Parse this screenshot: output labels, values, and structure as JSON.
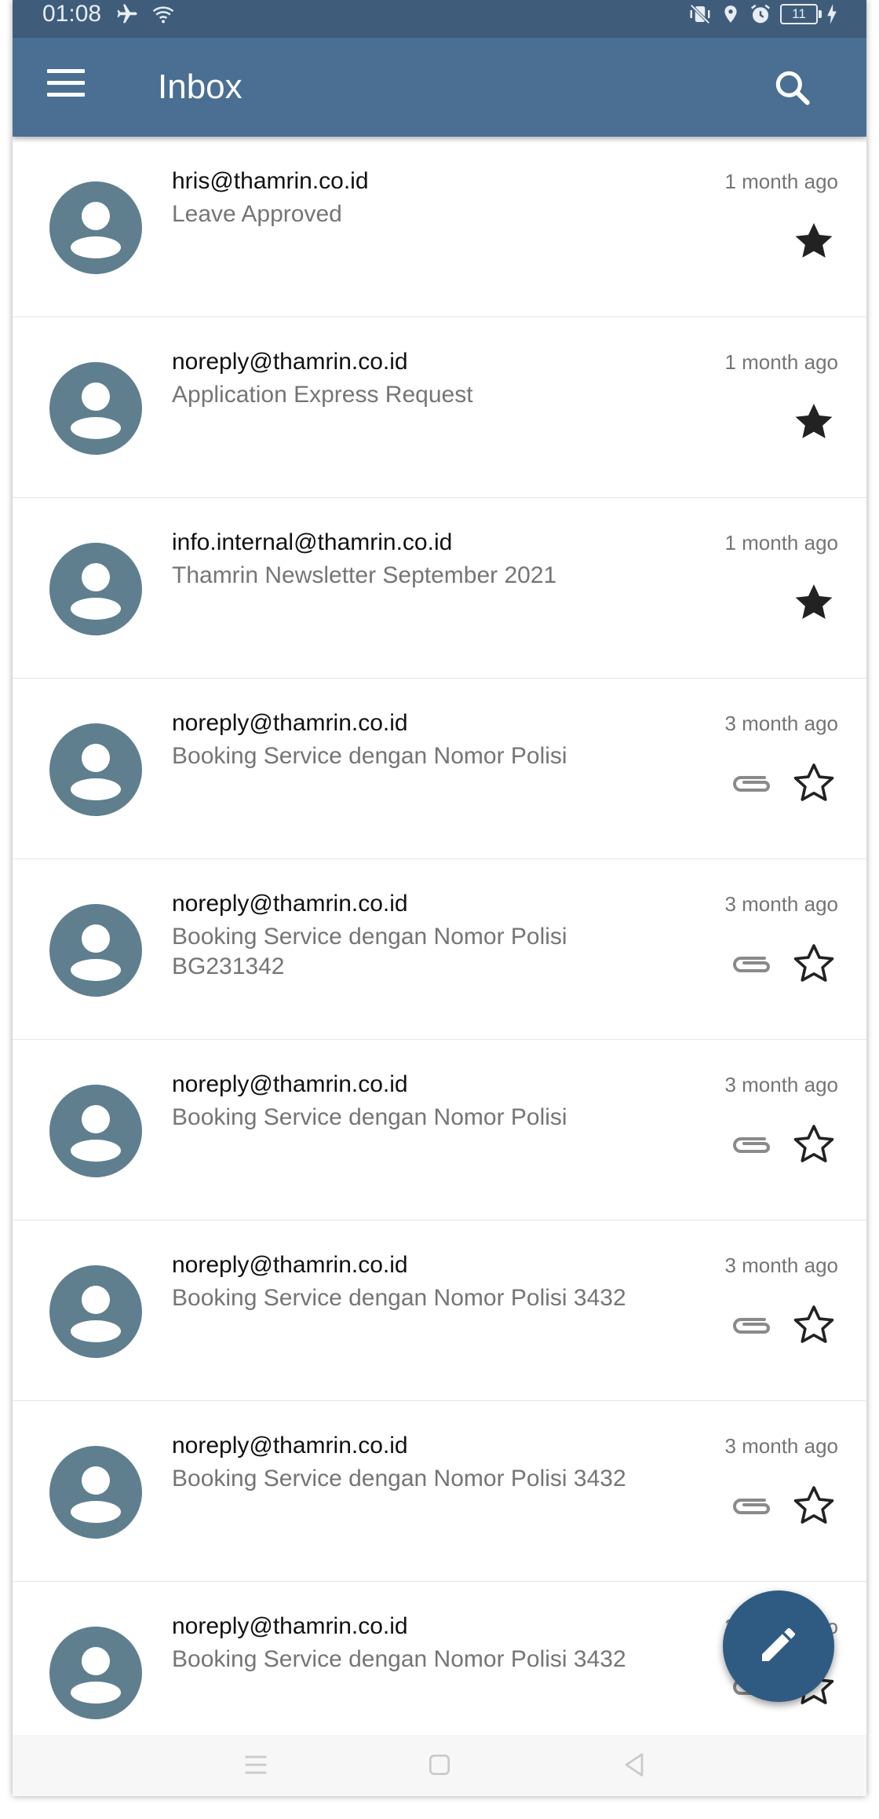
{
  "status_bar": {
    "time": "01:08",
    "battery": "11"
  },
  "app_bar": {
    "title": "Inbox",
    "menu_icon": "menu-icon",
    "search_icon": "search-icon"
  },
  "colors": {
    "status_bar": "#3f5d7b",
    "app_bar": "#4a6f92",
    "avatar": "#5f7f8f",
    "fab": "#2f5b83"
  },
  "emails": [
    {
      "sender": "hris@thamrin.co.id",
      "subject": "Leave Approved",
      "time": "1 month ago",
      "starred": true,
      "attachment": false
    },
    {
      "sender": "noreply@thamrin.co.id",
      "subject": "Application Express Request",
      "time": "1 month ago",
      "starred": true,
      "attachment": false
    },
    {
      "sender": "info.internal@thamrin.co.id",
      "subject": "Thamrin Newsletter September 2021",
      "time": "1 month ago",
      "starred": true,
      "attachment": false
    },
    {
      "sender": "noreply@thamrin.co.id",
      "subject": "Booking Service dengan Nomor Polisi",
      "time": "3 month ago",
      "starred": false,
      "attachment": true
    },
    {
      "sender": "noreply@thamrin.co.id",
      "subject": "Booking Service dengan Nomor Polisi BG231342",
      "time": "3 month ago",
      "starred": false,
      "attachment": true
    },
    {
      "sender": "noreply@thamrin.co.id",
      "subject": "Booking Service dengan Nomor Polisi",
      "time": "3 month ago",
      "starred": false,
      "attachment": true
    },
    {
      "sender": "noreply@thamrin.co.id",
      "subject": "Booking Service dengan Nomor Polisi 3432",
      "time": "3 month ago",
      "starred": false,
      "attachment": true
    },
    {
      "sender": "noreply@thamrin.co.id",
      "subject": "Booking Service dengan Nomor Polisi 3432",
      "time": "3 month ago",
      "starred": false,
      "attachment": true
    },
    {
      "sender": "noreply@thamrin.co.id",
      "subject": "Booking Service dengan Nomor Polisi 3432",
      "time": "3 month ago",
      "starred": false,
      "attachment": true
    }
  ],
  "fab": {
    "icon": "pencil-icon"
  },
  "nav_bar": {
    "icons": [
      "recents-icon",
      "home-icon",
      "back-icon"
    ]
  }
}
